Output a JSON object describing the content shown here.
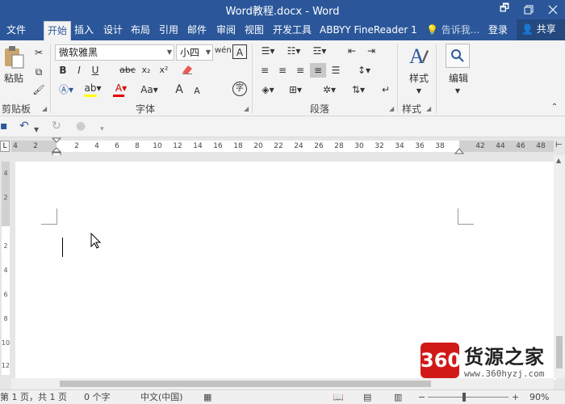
{
  "window": {
    "title": "Word教程.docx - Word",
    "controls": [
      "🗗",
      "□",
      "✕"
    ]
  },
  "tabs": [
    {
      "label": "文件"
    },
    {
      "label": "开始"
    },
    {
      "label": "插入"
    },
    {
      "label": "设计"
    },
    {
      "label": "布局"
    },
    {
      "label": "引用"
    },
    {
      "label": "邮件"
    },
    {
      "label": "审阅"
    },
    {
      "label": "视图"
    },
    {
      "label": "开发工具"
    },
    {
      "label": "ABBYY FineReader 1"
    }
  ],
  "tellme": "告诉我...",
  "login": "登录",
  "share": "共享",
  "ribbon": {
    "clipboard": {
      "paste_label": "粘贴",
      "group_label": "剪贴板"
    },
    "font": {
      "font_name": "微软雅黑",
      "font_size": "小四",
      "wen_glyph": "wén",
      "a_box": "A",
      "bold": "B",
      "italic": "I",
      "underline": "U",
      "strike": "abc",
      "sub": "x₂",
      "sup": "x²",
      "aa": "Aa",
      "grow": "A",
      "shrink": "A",
      "circle_char": "字",
      "group_label": "字体"
    },
    "paragraph": {
      "group_label": "段落"
    },
    "styles": {
      "button_label": "样式",
      "group_label": "样式"
    },
    "editing": {
      "button_label": "编辑"
    }
  },
  "ruler_ticks": [
    "4",
    "2",
    "2",
    "4",
    "6",
    "8",
    "10",
    "12",
    "14",
    "16",
    "18",
    "20",
    "22",
    "24",
    "26",
    "28",
    "30",
    "32",
    "34",
    "36",
    "38",
    "42",
    "44",
    "46",
    "48"
  ],
  "vruler_ticks": [
    "4",
    "2",
    "2",
    "4",
    "6",
    "8",
    "10",
    "12"
  ],
  "status": {
    "page": "第 1 页，共 1 页",
    "words": "0 个字",
    "lang": "中文(中国)",
    "zoom": "90%"
  },
  "watermark": {
    "logo_text": "360",
    "name": "货源之家",
    "url": "www.360hyzj.com"
  },
  "colors": {
    "brand": "#2b579a",
    "highlight": "#ffff00",
    "font_color": "#e00000"
  }
}
